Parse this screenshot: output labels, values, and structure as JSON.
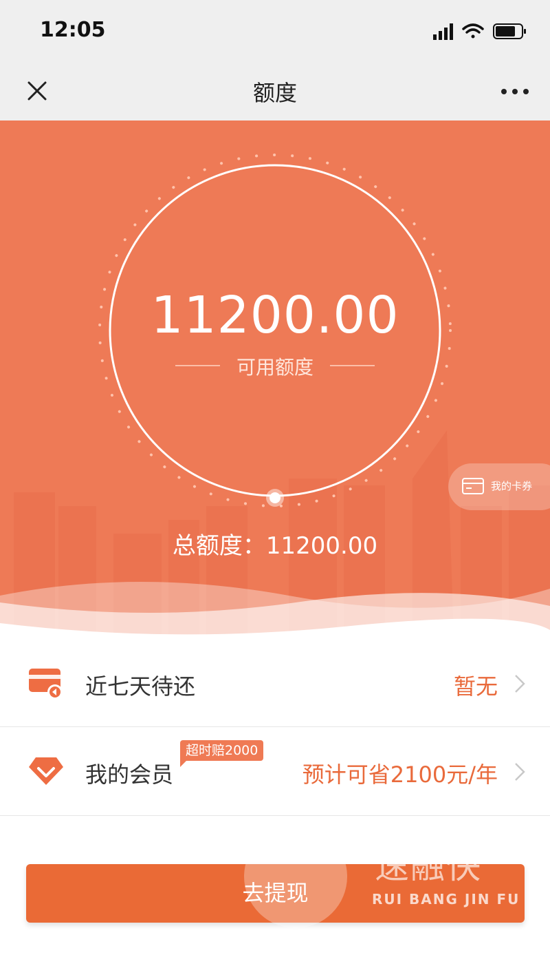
{
  "status": {
    "time": "12:05"
  },
  "nav": {
    "title": "额度"
  },
  "hero": {
    "amount": "11200.00",
    "amount_label": "可用额度",
    "total": "总额度：11200.00",
    "voucher_label": "我的卡券"
  },
  "rows": [
    {
      "label": "近七天待还",
      "value": "暂无",
      "icon": "card-icon"
    },
    {
      "label": "我的会员",
      "value": "预计可省2100元/年",
      "badge": "超时赔2000",
      "icon": "diamond-icon"
    }
  ],
  "cta": {
    "label": "去提现"
  },
  "watermark": {
    "text": "速融快",
    "sub": "RUI BANG JIN FU"
  },
  "colors": {
    "accent": "#ee7a56",
    "button": "#ea6a36",
    "value_text": "#e96a3b"
  }
}
